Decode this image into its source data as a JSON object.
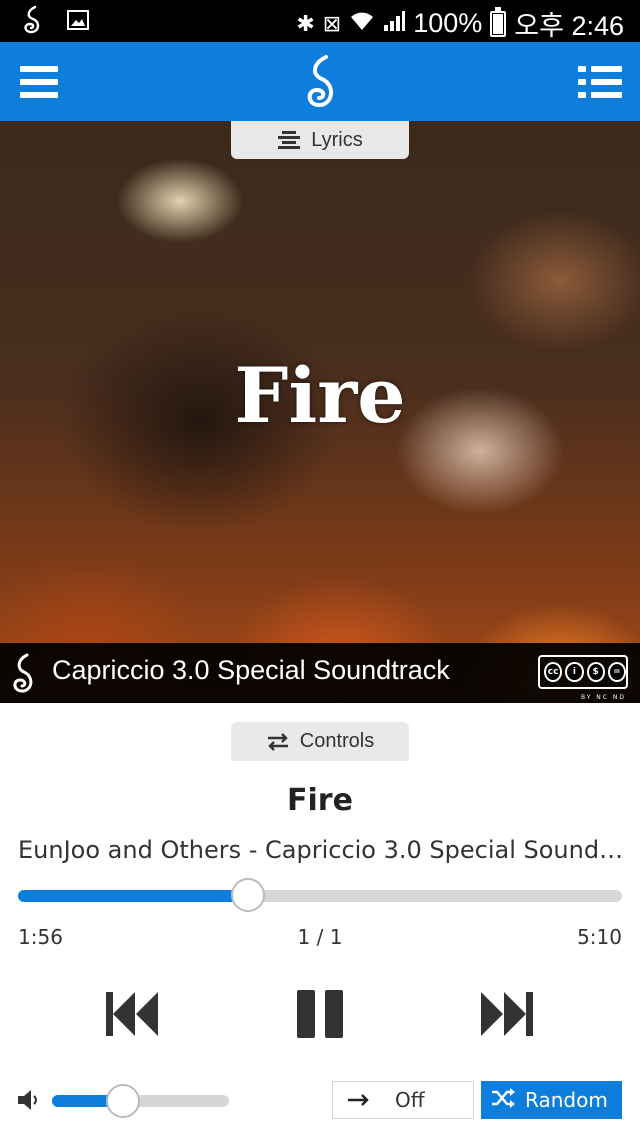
{
  "status_bar": {
    "battery": "100%",
    "time": "오후 2:46"
  },
  "album_art": {
    "title": "Fire",
    "banner_text": "Capriccio 3.0 Special Soundtrack",
    "license": "BY NC ND"
  },
  "tabs": {
    "lyrics_label": "Lyrics",
    "controls_label": "Controls"
  },
  "player": {
    "title": "Fire",
    "subtitle": "EunJoo and Others - Capriccio 3.0 Special Soundtrack",
    "elapsed": "1:56",
    "track_index": "1 / 1",
    "duration": "5:10",
    "progress_fraction": 0.38,
    "volume_fraction": 0.4,
    "repeat_label": "Off",
    "shuffle_label": "Random"
  },
  "colors": {
    "accent": "#0d7edb",
    "statusbar": "#000000",
    "track": "#d6d6d6"
  }
}
